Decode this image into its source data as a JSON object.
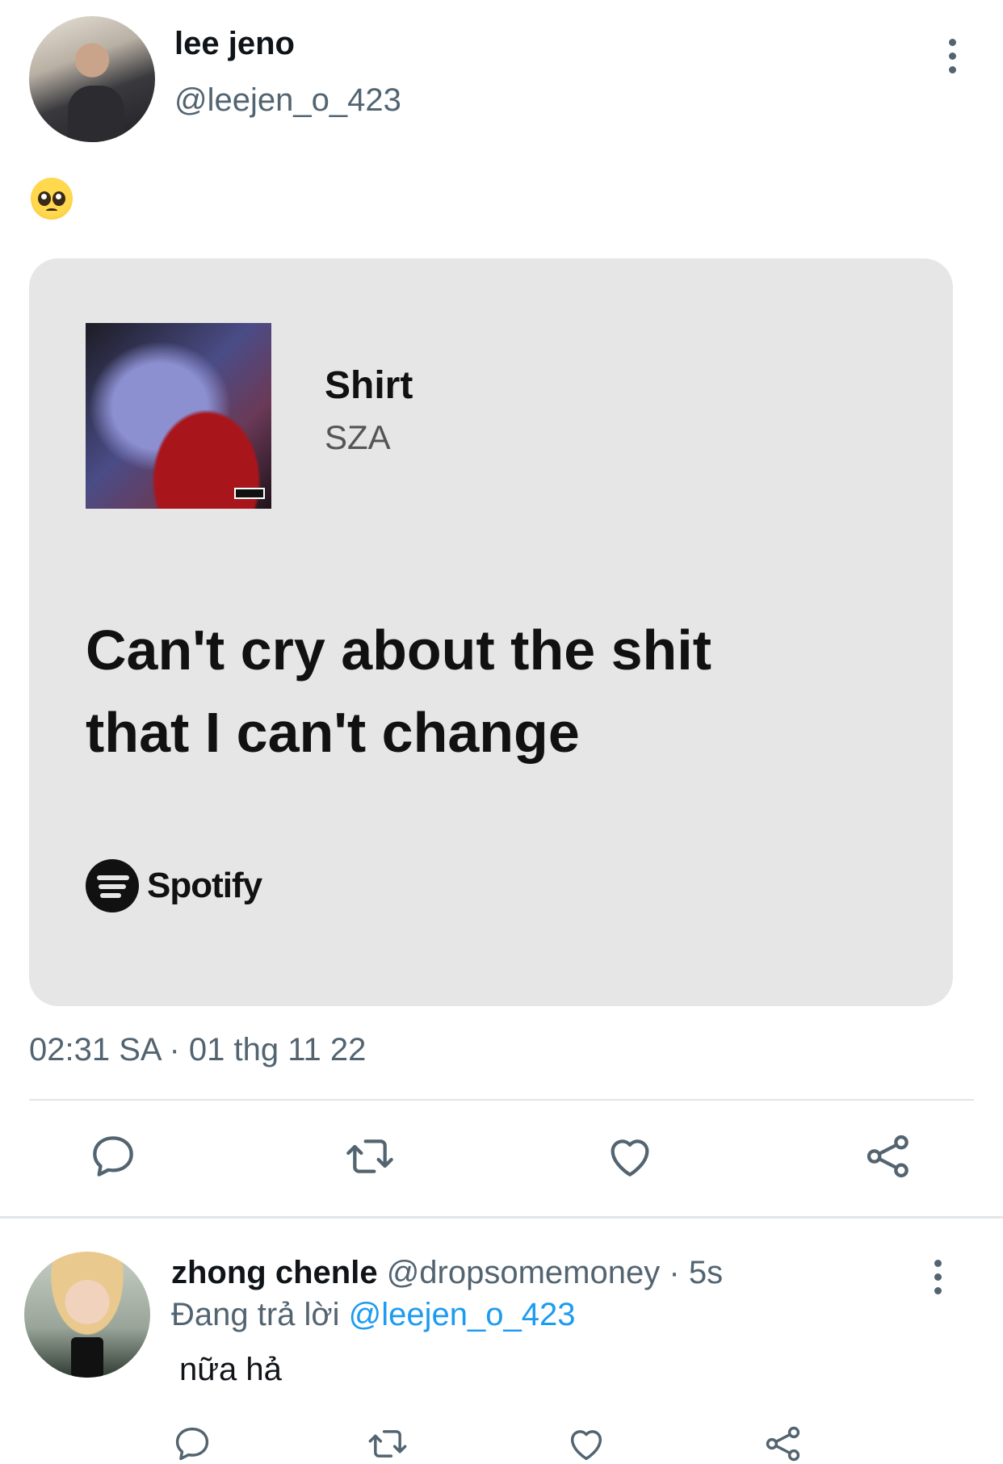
{
  "tweet": {
    "author_name": "lee jeno",
    "author_handle": "@leejen_o_423",
    "emoji": "pleading-face-emoji",
    "timestamp": "02:31 SA · 01 thg 11 22",
    "card": {
      "song_title": "Shirt",
      "song_artist": "SZA",
      "lyric_line1": "Can't cry about the shit",
      "lyric_line2": "that I can't change",
      "brand": "Spotify"
    },
    "actions": [
      "reply-icon",
      "retweet-icon",
      "like-icon",
      "share-icon"
    ]
  },
  "reply": {
    "author_name": "zhong chenle",
    "author_handle": "@dropsomemoney",
    "separator": "·",
    "time": "5s",
    "replying_prefix": "Đang trả lời",
    "replying_to": "@leejen_o_423",
    "text": "nữa hả",
    "actions": [
      "reply-icon",
      "retweet-icon",
      "like-icon",
      "share-icon"
    ]
  },
  "colors": {
    "text_primary": "#0f1419",
    "text_secondary": "#536471",
    "link": "#1d9bf0",
    "card_bg": "#e6e6e6"
  }
}
